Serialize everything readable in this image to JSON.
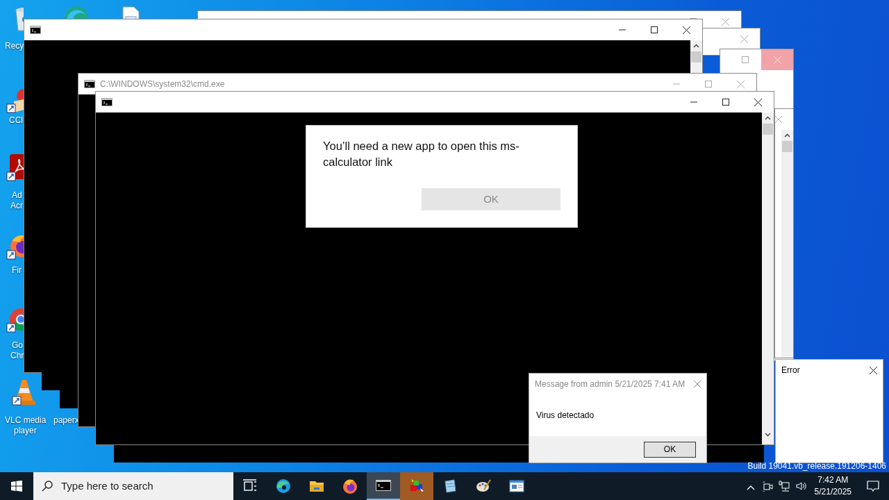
{
  "desktop_icons": [
    {
      "kind": "recycle",
      "lines": [
        "Recy"
      ]
    },
    {
      "kind": "edge"
    },
    {
      "kind": "document"
    },
    {
      "kind": "ccleaner",
      "lines": [
        "CCl"
      ]
    },
    {
      "kind": "acrobat",
      "lines": [
        "Ad",
        "Acr"
      ]
    },
    {
      "kind": "firefox",
      "lines": [
        "Fir"
      ]
    },
    {
      "kind": "chrome",
      "lines": [
        "Go",
        "Chr"
      ]
    },
    {
      "kind": "vlc",
      "lines": [
        "VLC media",
        "player"
      ]
    },
    {
      "kind": "hidden",
      "lines": [
        "paperx"
      ]
    }
  ],
  "windows": [
    {
      "kind": "back"
    },
    {
      "kind": "back"
    },
    {
      "kind": "back-alert"
    },
    {
      "kind": "side"
    },
    {
      "kind": "console"
    },
    {
      "kind": "console",
      "title": "C:\\WINDOWS\\system32\\cmd.exe"
    },
    {
      "kind": "console"
    }
  ],
  "dialog": {
    "message": "You’ll need a new app to open this ms-calculator link",
    "button": {
      "label": "OK",
      "disabled": true
    }
  },
  "message_box": {
    "title": "Message from admin 5/21/2025 7:41 AM",
    "body": "Virus detectado",
    "button": "OK"
  },
  "error_window": {
    "title": "Error"
  },
  "build_text": "Build 19041.vb_release.191206-1406",
  "taskbar": {
    "search": {
      "placeholder": "Type here to search"
    },
    "apps": [
      {
        "kind": "task-view",
        "active": false,
        "flashing": false
      },
      {
        "kind": "edge",
        "active": false,
        "flashing": false
      },
      {
        "kind": "explorer",
        "active": false,
        "flashing": false
      },
      {
        "kind": "firefox",
        "active": false,
        "flashing": false
      },
      {
        "kind": "console",
        "active": true,
        "flashing": false
      },
      {
        "kind": "cubes",
        "active": false,
        "flashing": true
      },
      {
        "kind": "notepad",
        "active": false,
        "flashing": false
      },
      {
        "kind": "paint",
        "active": false,
        "flashing": false
      },
      {
        "kind": "window",
        "active": false,
        "flashing": false
      }
    ],
    "tray": {
      "time": "7:42 AM",
      "date": "5/21/2025"
    }
  }
}
